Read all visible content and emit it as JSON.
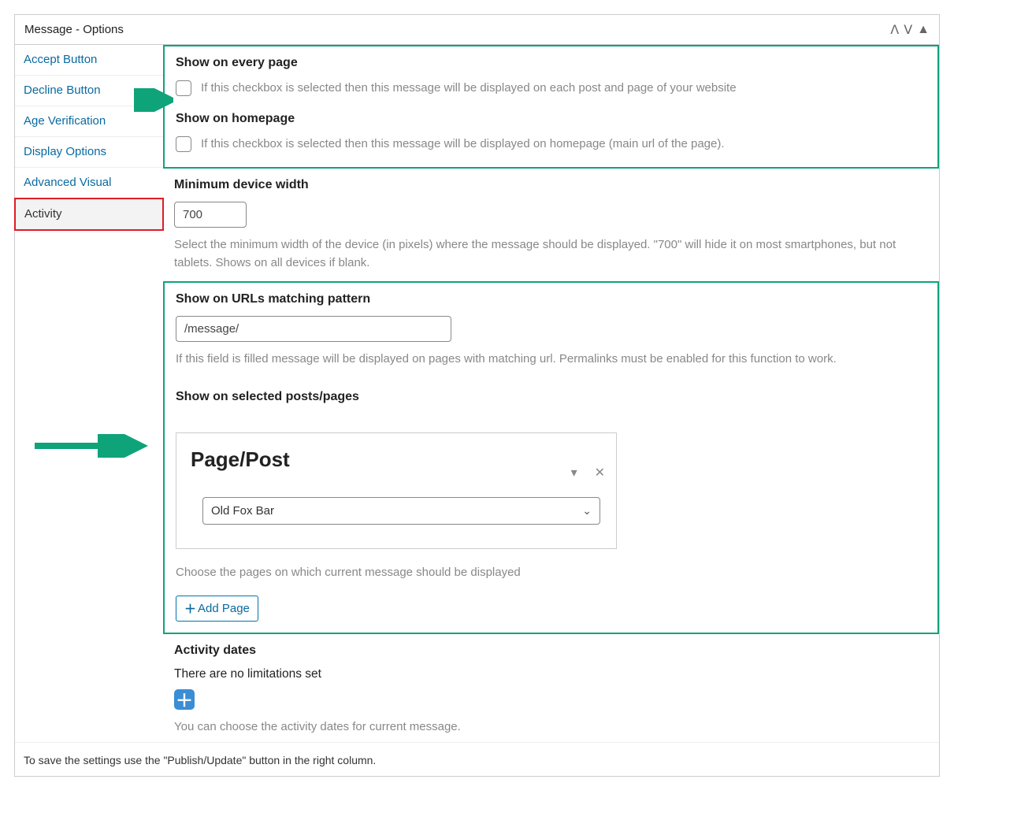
{
  "panel": {
    "title": "Message - Options"
  },
  "sidebar": {
    "items": [
      {
        "label": "Accept Button"
      },
      {
        "label": "Decline Button"
      },
      {
        "label": "Age Verification"
      },
      {
        "label": "Display Options"
      },
      {
        "label": "Advanced Visual"
      },
      {
        "label": "Activity"
      }
    ]
  },
  "sections": {
    "every_page": {
      "heading": "Show on every page",
      "help": "If this checkbox is selected then this message will be displayed on each post and page of your website"
    },
    "homepage": {
      "heading": "Show on homepage",
      "help": "If this checkbox is selected then this message will be displayed on homepage (main url of the page)."
    },
    "min_width": {
      "heading": "Minimum device width",
      "value": "700",
      "help": "Select the minimum width of the device (in pixels) where the message should be displayed. \"700\" will hide it on most smartphones, but not tablets. Shows on all devices if blank."
    },
    "url_pattern": {
      "heading": "Show on URLs matching pattern",
      "value": "/message/",
      "help": "If this field is filled message will be displayed on pages with matching url. Permalinks must be enabled for this function to work."
    },
    "selected_pages": {
      "heading": "Show on selected posts/pages",
      "card_title": "Page/Post",
      "select_value": "Old Fox Bar",
      "choose_help": "Choose the pages on which current message should be displayed",
      "add_button": "Add Page"
    },
    "activity_dates": {
      "heading": "Activity dates",
      "status": "There are no limitations set",
      "help": "You can choose the activity dates for current message."
    }
  },
  "footer": {
    "note": "To save the settings use the \"Publish/Update\" button in the right column."
  }
}
